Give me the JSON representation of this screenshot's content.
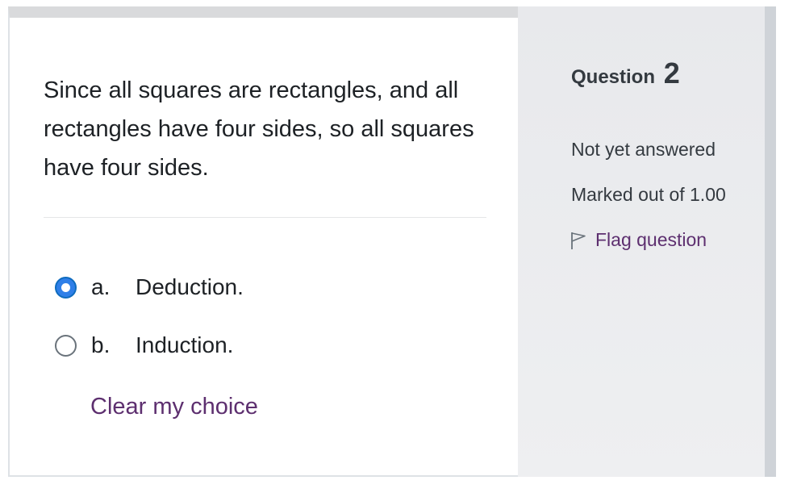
{
  "question": {
    "text": "Since all squares are rectangles, and all rectangles have four sides, so all squares have four sides.",
    "options": [
      {
        "letter": "a.",
        "label": "Deduction.",
        "checked": true
      },
      {
        "letter": "b.",
        "label": "Induction.",
        "checked": false
      }
    ],
    "clear_label": "Clear my choice"
  },
  "info": {
    "heading": "Question",
    "number": "2",
    "state": "Not yet answered",
    "grade": "Marked out of 1.00",
    "flag_label": "Flag question",
    "flag_icon": "flag-outline-icon"
  },
  "colors": {
    "link": "#5d2f6f",
    "radio_checked": "#2f7fe8",
    "info_bg": "#e8e9ec"
  }
}
